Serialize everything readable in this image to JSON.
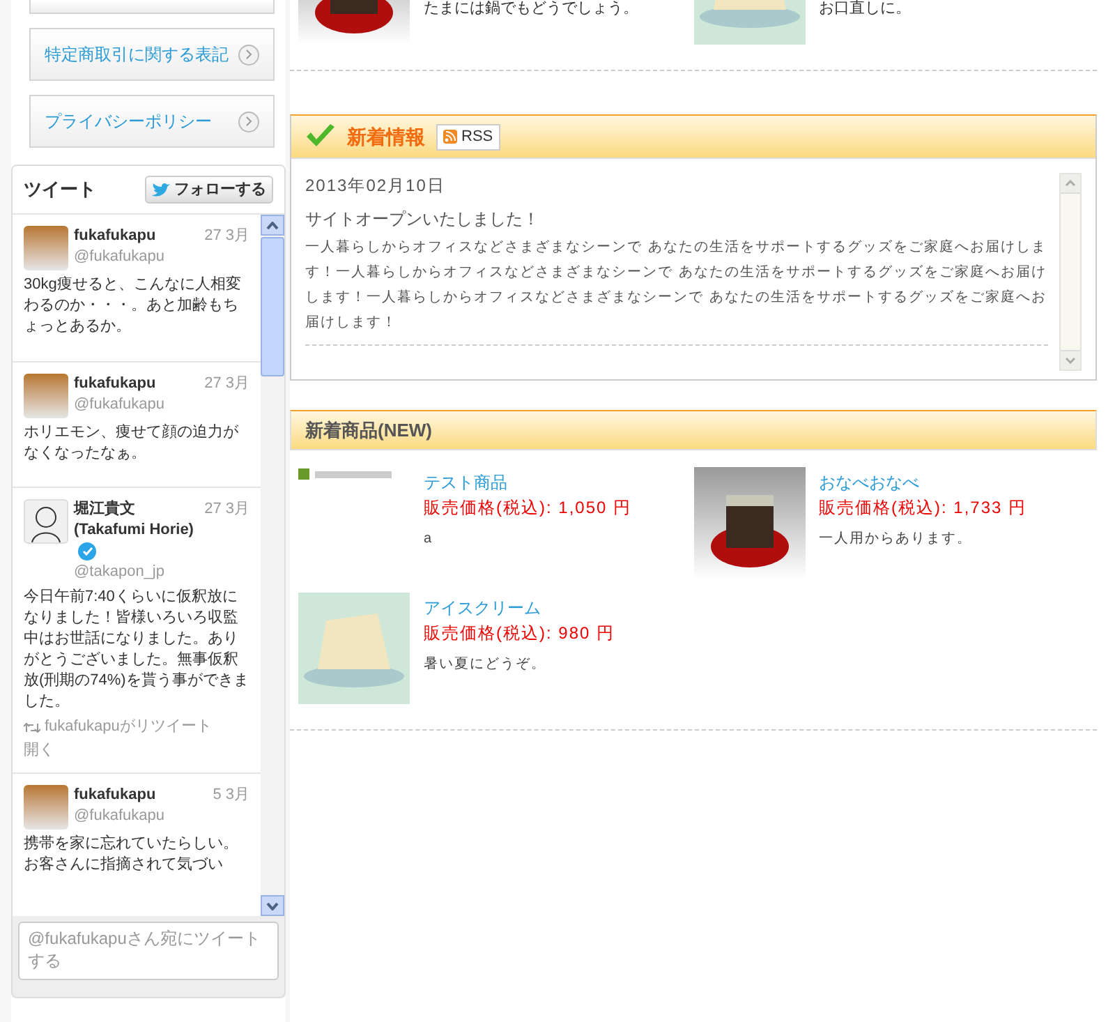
{
  "sidebar": {
    "links": [
      {
        "label": "特定商取引に関する表記"
      },
      {
        "label": "プライバシーポリシー"
      }
    ]
  },
  "twitter": {
    "title": "ツイート",
    "follow_button": "フォローする",
    "tweets": [
      {
        "author": "fukafukapu",
        "verified": false,
        "date": "27 3月",
        "handle": "@fukafukapu",
        "text": "30kg痩せると、こんなに人相変わるのか・・・。あと加齢もちょっとあるか。"
      },
      {
        "author": "fukafukapu",
        "verified": false,
        "date": "27 3月",
        "handle": "@fukafukapu",
        "text": "ホリエモン、痩せて顔の迫力がなくなったなぁ。"
      },
      {
        "author": "堀江貴文 (Takafumi Horie)",
        "verified": true,
        "date": "27 3月",
        "handle": "@takapon_jp",
        "text": "今日午前7:40くらいに仮釈放になりました！皆様いろいろ収監中はお世話になりました。ありがとうございました。無事仮釈放(刑期の74%)を貰う事ができました。",
        "retweeted_by": "fukafukapuがリツイート",
        "expand": "開く"
      },
      {
        "author": "fukafukapu",
        "verified": false,
        "date": "5 3月",
        "handle": "@fukafukapu",
        "text": "携帯を家に忘れていたらしい。お客さんに指摘されて気づい"
      }
    ],
    "reply_placeholder": "@fukafukapuさん宛にツイートする"
  },
  "top_products": [
    {
      "description": "たまには鍋でもどうでしょう。"
    },
    {
      "description": "お口直しに。"
    }
  ],
  "news": {
    "title": "新着情報",
    "rss": "RSS",
    "entries": [
      {
        "date": "2013年02月10日",
        "headline": "サイトオープンいたしました！",
        "body": "一人暮らしからオフィスなどさまざまなシーンで あなたの生活をサポートするグッズをご家庭へお届けします！一人暮らしからオフィスなどさまざまなシーンで あなたの生活をサポートするグッズをご家庭へお届けします！一人暮らしからオフィスなどさまざまなシーンで あなたの生活をサポートするグッズをご家庭へお届けします！"
      }
    ]
  },
  "new_products": {
    "title": "新着商品(NEW)",
    "items": [
      {
        "name": "テスト商品",
        "price": "販売価格(税込): 1,050 円",
        "description": "a"
      },
      {
        "name": "おなべおなべ",
        "price": "販売価格(税込): 1,733 円",
        "description": "一人用からあります。"
      },
      {
        "name": "アイスクリーム",
        "price": "販売価格(税込): 980 円",
        "description": "暑い夏にどうぞ。"
      }
    ]
  }
}
